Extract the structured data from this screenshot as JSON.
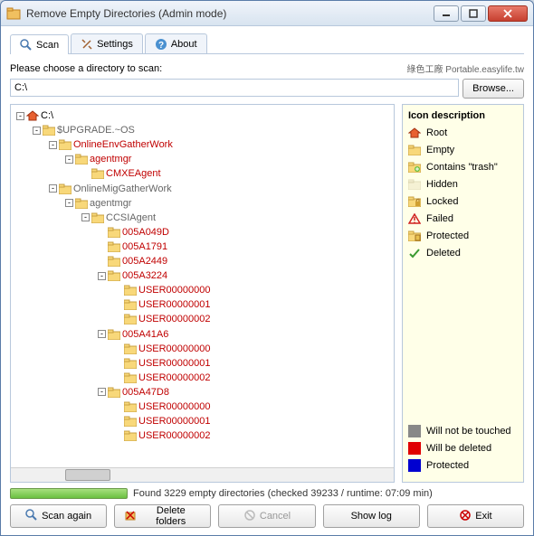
{
  "window": {
    "title": "Remove Empty Directories (Admin mode)"
  },
  "tabs": {
    "scan": "Scan",
    "settings": "Settings",
    "about": "About"
  },
  "choose_label": "Please choose a directory to scan:",
  "attribution": "綠色工廠 Portable.easylife.tw",
  "dir_value": "C:\\",
  "browse_label": "Browse...",
  "tree": [
    {
      "depth": 0,
      "exp": "-",
      "icon": "root",
      "label": "C:\\",
      "cls": ""
    },
    {
      "depth": 1,
      "exp": "-",
      "icon": "folder",
      "label": "$UPGRADE.~OS",
      "cls": "gray"
    },
    {
      "depth": 2,
      "exp": "-",
      "icon": "folder",
      "label": "OnlineEnvGatherWork",
      "cls": "red"
    },
    {
      "depth": 3,
      "exp": "-",
      "icon": "folder",
      "label": "agentmgr",
      "cls": "red"
    },
    {
      "depth": 4,
      "exp": "",
      "icon": "folder",
      "label": "CMXEAgent",
      "cls": "red"
    },
    {
      "depth": 2,
      "exp": "-",
      "icon": "folder",
      "label": "OnlineMigGatherWork",
      "cls": "gray"
    },
    {
      "depth": 3,
      "exp": "-",
      "icon": "folder",
      "label": "agentmgr",
      "cls": "gray"
    },
    {
      "depth": 4,
      "exp": "-",
      "icon": "folder",
      "label": "CCSIAgent",
      "cls": "gray"
    },
    {
      "depth": 5,
      "exp": "",
      "icon": "folder",
      "label": "005A049D",
      "cls": "red"
    },
    {
      "depth": 5,
      "exp": "",
      "icon": "folder",
      "label": "005A1791",
      "cls": "red"
    },
    {
      "depth": 5,
      "exp": "",
      "icon": "folder",
      "label": "005A2449",
      "cls": "red"
    },
    {
      "depth": 5,
      "exp": "-",
      "icon": "folder",
      "label": "005A3224",
      "cls": "red"
    },
    {
      "depth": 6,
      "exp": "",
      "icon": "folder",
      "label": "USER00000000",
      "cls": "red"
    },
    {
      "depth": 6,
      "exp": "",
      "icon": "folder",
      "label": "USER00000001",
      "cls": "red"
    },
    {
      "depth": 6,
      "exp": "",
      "icon": "folder",
      "label": "USER00000002",
      "cls": "red"
    },
    {
      "depth": 5,
      "exp": "-",
      "icon": "folder",
      "label": "005A41A6",
      "cls": "red"
    },
    {
      "depth": 6,
      "exp": "",
      "icon": "folder",
      "label": "USER00000000",
      "cls": "red"
    },
    {
      "depth": 6,
      "exp": "",
      "icon": "folder",
      "label": "USER00000001",
      "cls": "red"
    },
    {
      "depth": 6,
      "exp": "",
      "icon": "folder",
      "label": "USER00000002",
      "cls": "red"
    },
    {
      "depth": 5,
      "exp": "-",
      "icon": "folder",
      "label": "005A47D8",
      "cls": "red"
    },
    {
      "depth": 6,
      "exp": "",
      "icon": "folder",
      "label": "USER00000000",
      "cls": "red"
    },
    {
      "depth": 6,
      "exp": "",
      "icon": "folder",
      "label": "USER00000001",
      "cls": "red"
    },
    {
      "depth": 6,
      "exp": "",
      "icon": "folder",
      "label": "USER00000002",
      "cls": "red"
    }
  ],
  "legend": {
    "title": "Icon description",
    "items": [
      {
        "icon": "root",
        "label": "Root"
      },
      {
        "icon": "empty",
        "label": "Empty"
      },
      {
        "icon": "trash",
        "label": "Contains \"trash\""
      },
      {
        "icon": "hidden",
        "label": "Hidden"
      },
      {
        "icon": "locked",
        "label": "Locked"
      },
      {
        "icon": "failed",
        "label": "Failed"
      },
      {
        "icon": "protected",
        "label": "Protected"
      },
      {
        "icon": "deleted",
        "label": "Deleted"
      }
    ],
    "colors": [
      {
        "cls": "gray",
        "label": "Will not be touched"
      },
      {
        "cls": "red",
        "label": "Will be deleted"
      },
      {
        "cls": "blue",
        "label": "Protected"
      }
    ]
  },
  "status": "Found 3229 empty directories (checked 39233 / runtime: 07:09 min)",
  "buttons": {
    "scan_again": "Scan again",
    "delete_folders": "Delete folders",
    "cancel": "Cancel",
    "show_log": "Show log",
    "exit": "Exit"
  }
}
